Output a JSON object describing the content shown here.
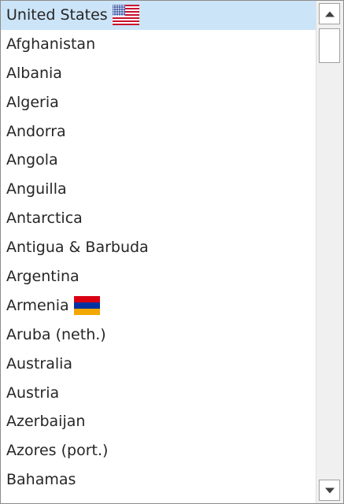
{
  "countries": [
    {
      "label": "United States",
      "selected": true,
      "flag": "us-flag-icon"
    },
    {
      "label": "Afghanistan"
    },
    {
      "label": "Albania"
    },
    {
      "label": "Algeria"
    },
    {
      "label": "Andorra"
    },
    {
      "label": "Angola"
    },
    {
      "label": "Anguilla"
    },
    {
      "label": "Antarctica"
    },
    {
      "label": "Antigua & Barbuda"
    },
    {
      "label": "Argentina"
    },
    {
      "label": "Armenia",
      "flag": "armenia-flag-icon"
    },
    {
      "label": "Aruba (neth.)"
    },
    {
      "label": "Australia"
    },
    {
      "label": "Austria"
    },
    {
      "label": "Azerbaijan"
    },
    {
      "label": "Azores (port.)"
    },
    {
      "label": "Bahamas"
    }
  ],
  "colors": {
    "selection": "#cce4f7",
    "text": "#262626",
    "border": "#8c8c8c",
    "scrollbar_track": "#f0f0f0"
  },
  "scrollbar": {
    "up_icon": "scroll-up-arrow-icon",
    "down_icon": "scroll-down-arrow-icon"
  }
}
